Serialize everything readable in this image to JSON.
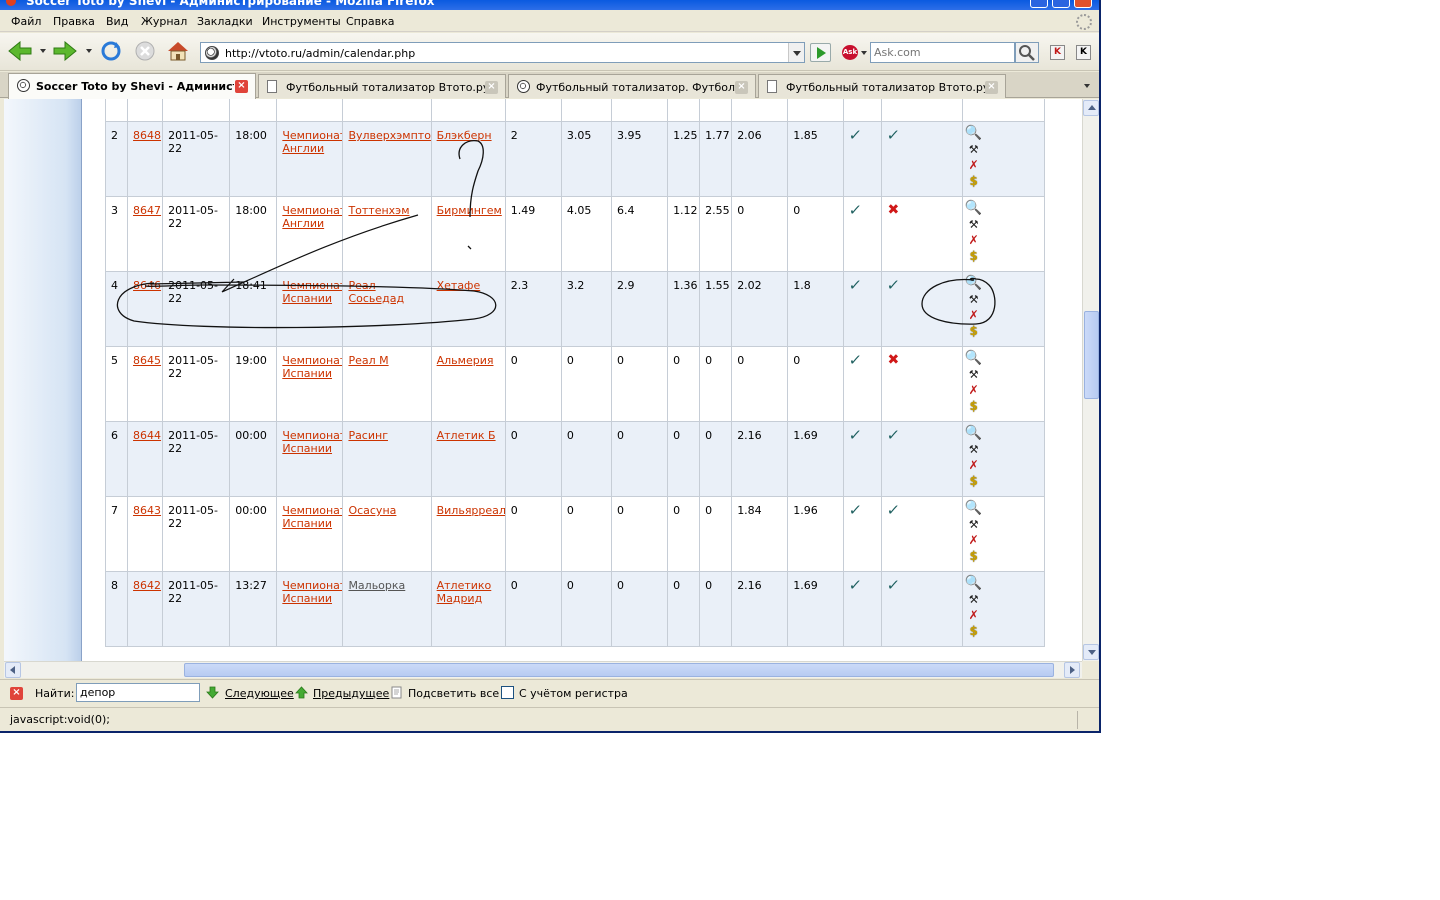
{
  "window": {
    "title": "Soccer Toto by Shevi - Администрирование - Mozilla Firefox"
  },
  "menu": [
    "Файл",
    "Правка",
    "Вид",
    "Журнал",
    "Закладки",
    "Инструменты",
    "Справка"
  ],
  "address_bar": {
    "url": "http://vtoto.ru/admin/calendar.php"
  },
  "search": {
    "engine": "Ask",
    "placeholder": "Ask.com"
  },
  "tabs": [
    {
      "label": "Soccer Toto by Shevi - Админист...",
      "active": true,
      "icon": "soccer-ball-icon"
    },
    {
      "label": "Футбольный тотализатор Втото.ру ...",
      "active": false,
      "icon": "page-icon"
    },
    {
      "label": "Футбольный тотализатор. Футбол ...",
      "active": false,
      "icon": "soccer-ball-icon"
    },
    {
      "label": "Футбольный тотализатор Втото.ру ...",
      "active": false,
      "icon": "page-icon"
    }
  ],
  "matches": [
    {
      "n": "",
      "id": "",
      "date": "",
      "time": "",
      "league": "",
      "home": "",
      "away": "",
      "o1": "",
      "o2": "",
      "o3": "",
      "o4": "",
      "o5": "",
      "o6": "",
      "o7": "",
      "check1": "",
      "check2": "",
      "partial": true
    },
    {
      "n": "2",
      "id": "8648",
      "date": "2011-05-22",
      "time": "18:00",
      "league": "Чемпионат Англии",
      "home": "Вулверхэмптон",
      "away": "Блэкберн",
      "o1": "2",
      "o2": "3.05",
      "o3": "3.95",
      "o4": "1.25",
      "o5": "1.77",
      "o6": "2.06",
      "o7": "1.85",
      "check1": "ok",
      "check2": "ok"
    },
    {
      "n": "3",
      "id": "8647",
      "date": "2011-05-22",
      "time": "18:00",
      "league": "Чемпионат Англии",
      "home": "Тоттенхэм",
      "away": "Бирмингем",
      "o1": "1.49",
      "o2": "4.05",
      "o3": "6.4",
      "o4": "1.12",
      "o5": "2.55",
      "o6": "0",
      "o7": "0",
      "check1": "ok",
      "check2": "fail"
    },
    {
      "n": "4",
      "id": "8646",
      "date": "2011-05-22",
      "time": "18:41",
      "league": "Чемпионат Испании",
      "home": "Реал Сосьедад",
      "away": "Хетафе",
      "o1": "2.3",
      "o2": "3.2",
      "o3": "2.9",
      "o4": "1.36",
      "o5": "1.55",
      "o6": "2.02",
      "o7": "1.8",
      "check1": "ok",
      "check2": "ok"
    },
    {
      "n": "5",
      "id": "8645",
      "date": "2011-05-22",
      "time": "19:00",
      "league": "Чемпионат Испании",
      "home": "Реал М",
      "away": "Альмерия",
      "o1": "0",
      "o2": "0",
      "o3": "0",
      "o4": "0",
      "o5": "0",
      "o6": "0",
      "o7": "0",
      "check1": "ok",
      "check2": "fail"
    },
    {
      "n": "6",
      "id": "8644",
      "date": "2011-05-22",
      "time": "00:00",
      "league": "Чемпионат Испании",
      "home": "Расинг",
      "away": "Атлетик Б",
      "o1": "0",
      "o2": "0",
      "o3": "0",
      "o4": "0",
      "o5": "0",
      "o6": "2.16",
      "o7": "1.69",
      "check1": "ok",
      "check2": "ok"
    },
    {
      "n": "7",
      "id": "8643",
      "date": "2011-05-22",
      "time": "00:00",
      "league": "Чемпионат Испании",
      "home": "Осасуна",
      "away": "Вильярреал",
      "o1": "0",
      "o2": "0",
      "o3": "0",
      "o4": "0",
      "o5": "0",
      "o6": "1.84",
      "o7": "1.96",
      "check1": "ok",
      "check2": "ok"
    },
    {
      "n": "8",
      "id": "8642",
      "date": "2011-05-22",
      "time": "13:27",
      "league": "Чемпионат Испании",
      "home": "Мальорка",
      "away": "Атлетико Мадрид",
      "o1": "0",
      "o2": "0",
      "o3": "0",
      "o4": "0",
      "o5": "0",
      "o6": "2.16",
      "o7": "1.69",
      "check1": "ok",
      "check2": "ok",
      "home_grey": true
    }
  ],
  "findbar": {
    "label": "Найти:",
    "value": "депор",
    "next": "Следующее",
    "prev": "Предыдущее",
    "highlight": "Подсветить все",
    "case": "С учётом регистра"
  },
  "status": {
    "text": "javascript:void(0);"
  },
  "colors": {
    "link": "#cc3300",
    "check": "#1c5e5e",
    "fail": "#d01818",
    "row_alt": "#eaf0f8"
  }
}
